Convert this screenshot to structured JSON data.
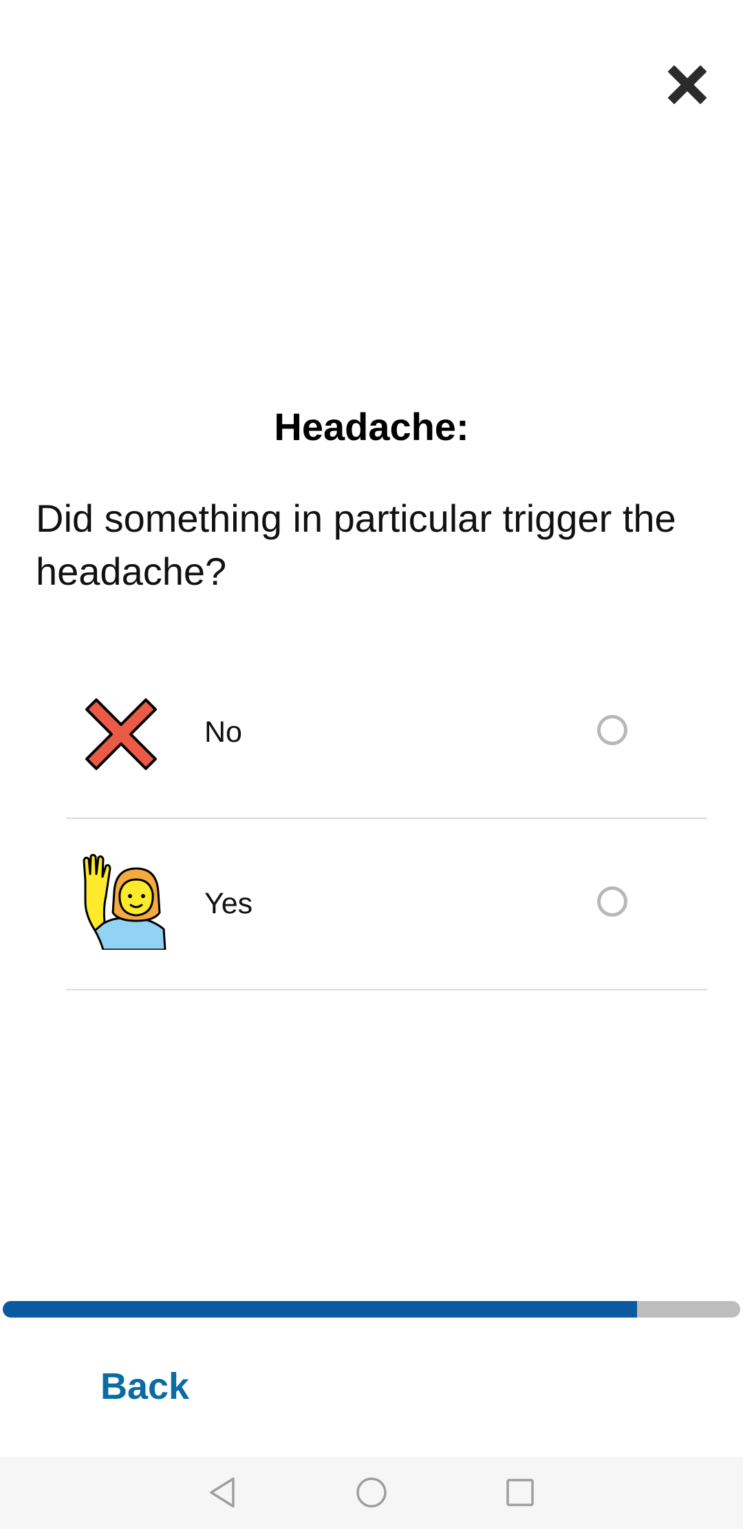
{
  "header": {
    "close_icon": "close-x-icon"
  },
  "survey": {
    "title": "Headache:",
    "question": "Did something in particular trigger the headache?",
    "options": [
      {
        "label": "No",
        "icon": "red-cross-icon",
        "selected": false
      },
      {
        "label": "Yes",
        "icon": "person-raising-hand-icon",
        "selected": false
      }
    ]
  },
  "progress": {
    "fraction": 0.86,
    "fill_color": "#0b5aa0",
    "track_color": "#bdbdbd"
  },
  "footer": {
    "back_label": "Back",
    "accent_color": "#0b6ba3"
  },
  "system_nav": {
    "buttons": [
      "back-triangle-icon",
      "home-circle-icon",
      "recents-square-icon"
    ]
  }
}
